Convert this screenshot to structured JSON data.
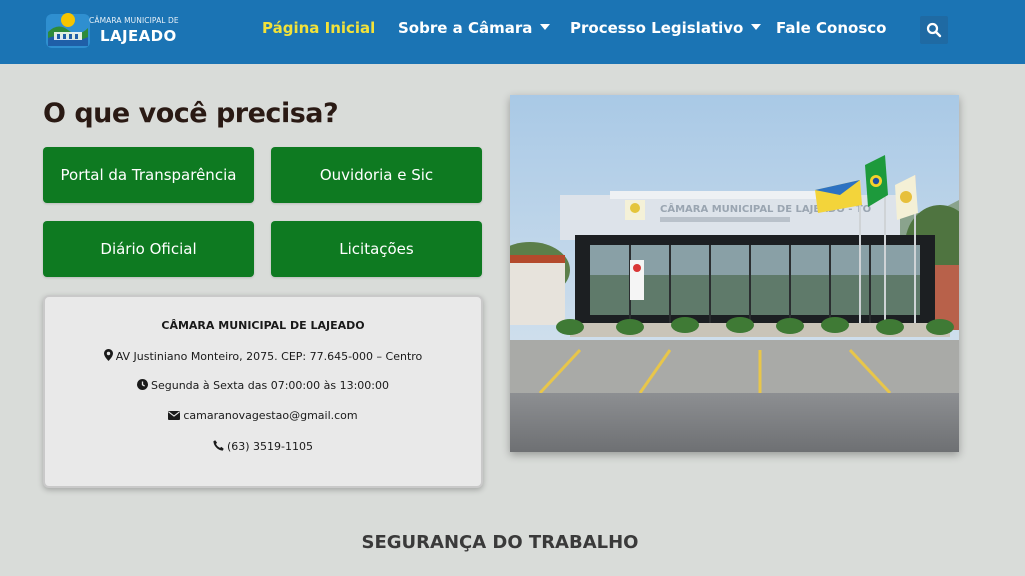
{
  "header": {
    "brand_small": "CÂMARA MUNICIPAL DE",
    "brand_big": "LAJEADO",
    "nav": [
      {
        "label": "Página Inicial"
      },
      {
        "label": "Sobre a Câmara"
      },
      {
        "label": "Processo Legislativo"
      },
      {
        "label": "Fale Conosco"
      }
    ],
    "search_icon": "search-icon",
    "colors": {
      "bar": "#1b74b4",
      "active_nav": "#f2e23a"
    }
  },
  "main": {
    "heading": "O que você precisa?",
    "quick_links": [
      {
        "label": "Portal da Transparência"
      },
      {
        "label": "Ouvidoria e Sic"
      },
      {
        "label": "Diário Oficial"
      },
      {
        "label": "Licitações"
      }
    ],
    "button_color": "#0e7a21",
    "info": {
      "title": "CÂMARA MUNICIPAL DE LAJEADO",
      "address": "AV Justiniano Monteiro, 2075. CEP: 77.645-000 – Centro",
      "hours": "Segunda à Sexta das 07:00:00 às 13:00:00",
      "email": "camaranovagestao@gmail.com",
      "phone": "(63) 3519-1105",
      "icons": [
        "map-marker-icon",
        "clock-icon",
        "envelope-icon",
        "phone-icon"
      ]
    },
    "photo_sign": "CÂMARA MUNICIPAL DE LAJEADO - TO",
    "section_title": "SEGURANÇA DO TRABALHO"
  }
}
